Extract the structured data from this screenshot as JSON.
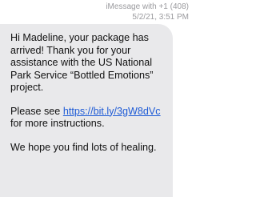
{
  "header": {
    "service_line": "iMessage with +1 (408)",
    "timestamp": "5/2/21, 3:51 PM"
  },
  "message": {
    "paragraph1": "Hi Madeline, your package has arrived! Thank you for your assistance with the US National Park Service “Bottled Emotions” project.",
    "paragraph2_prefix": "Please see ",
    "link_text": "https://bit.ly/3gW8dVc",
    "paragraph2_suffix": " for more instructions.",
    "paragraph3": "We hope you find lots of healing."
  },
  "colors": {
    "bubble_background": "#e9e9eb",
    "link": "#1e5bd6",
    "header_text": "#9a9a9e"
  }
}
